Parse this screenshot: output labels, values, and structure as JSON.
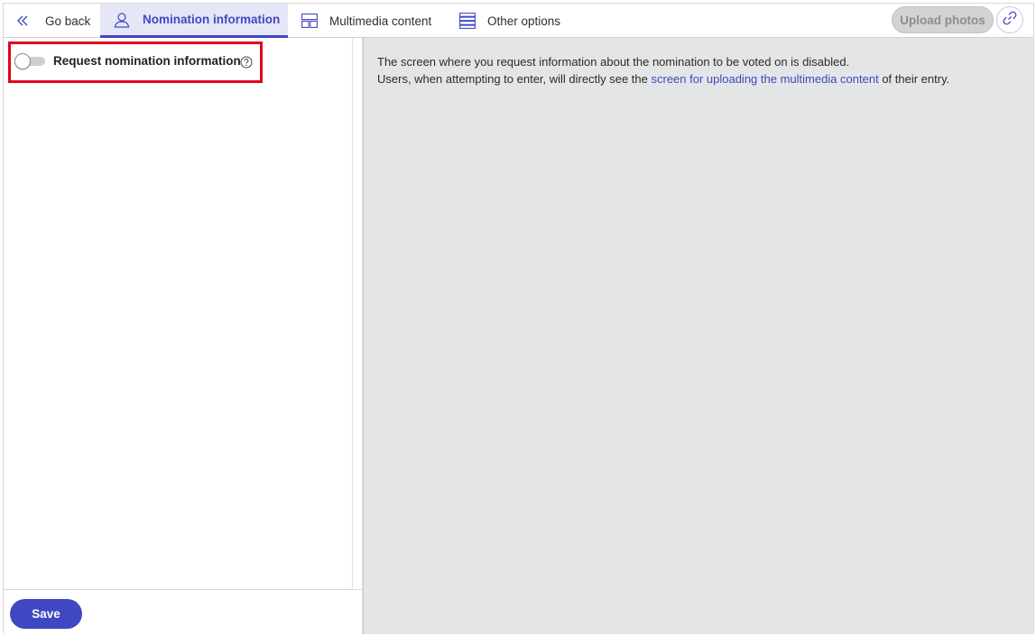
{
  "nav": {
    "back": {
      "label": "Go back",
      "icon": "double-chevron-left-icon"
    },
    "tabs": [
      {
        "label": "Nomination information",
        "icon": "user-icon",
        "active": true
      },
      {
        "label": "Multimedia content",
        "icon": "layout-icon",
        "active": false
      },
      {
        "label": "Other options",
        "icon": "list-icon",
        "active": false
      }
    ],
    "upload_label": "Upload photos",
    "link_icon": "link-icon"
  },
  "left": {
    "toggle_label": "Request nomination information",
    "toggle_on": false,
    "help_icon": "question-circle-icon"
  },
  "footer": {
    "save_label": "Save"
  },
  "info": {
    "line1": "The screen where you request information about the nomination to be voted on is disabled.",
    "line2_prefix": "Users, when attempting to enter, will directly see the ",
    "line2_link": "screen for uploading the multimedia content",
    "line2_suffix": " of their entry."
  },
  "colors": {
    "accent": "#3f48c2",
    "active_tab_bg": "#e6e7f6",
    "highlight": "#e3001b",
    "right_bg": "#e4e5e7"
  }
}
